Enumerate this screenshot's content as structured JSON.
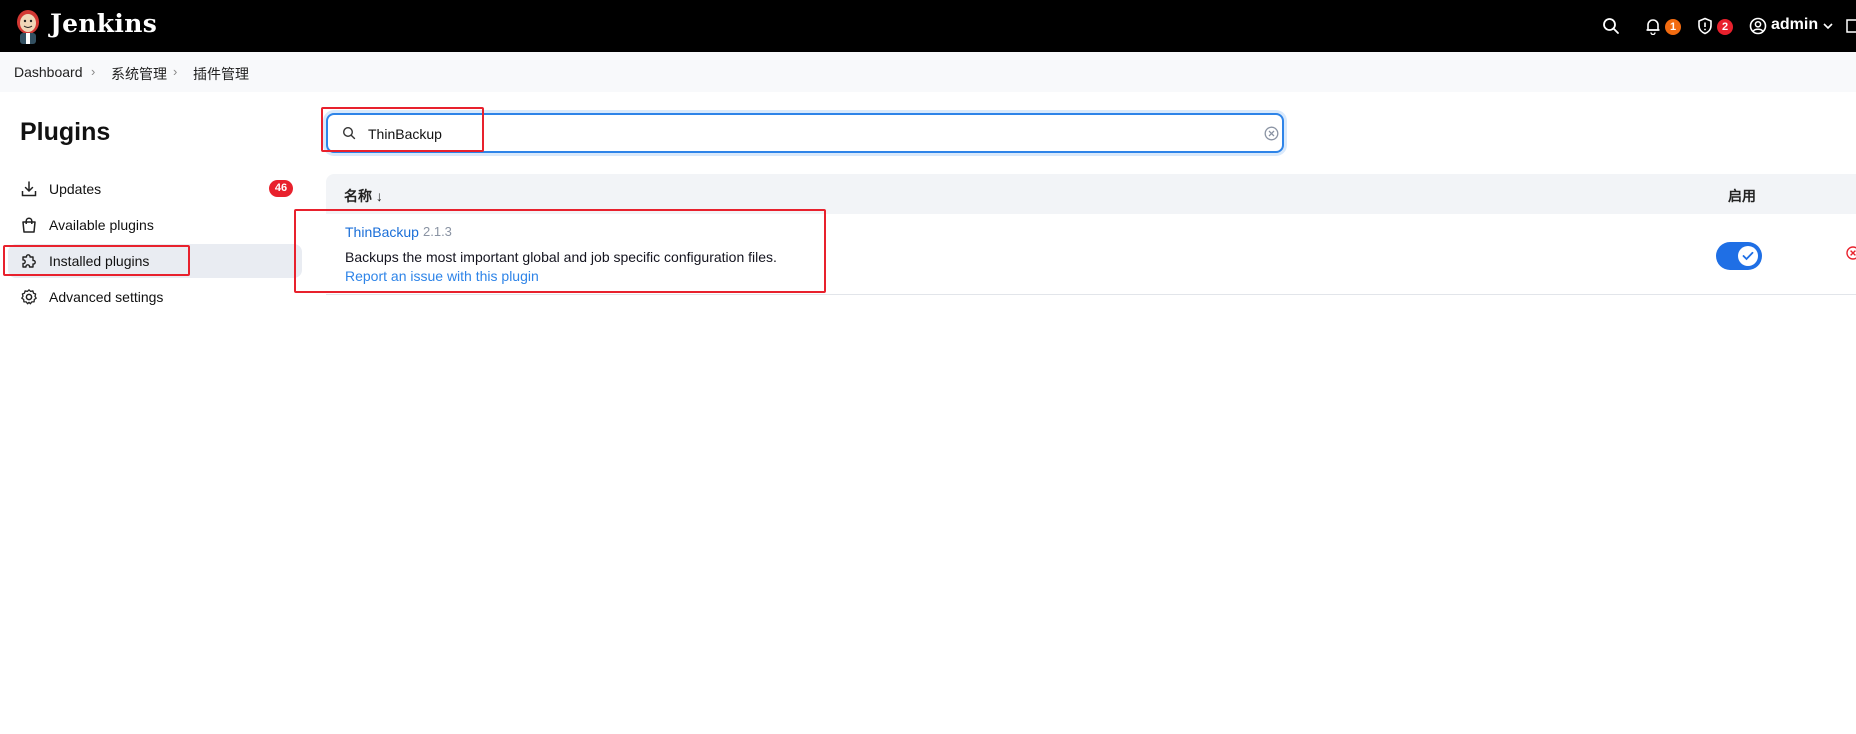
{
  "header": {
    "brand": "Jenkins",
    "notifications_count": "1",
    "security_count": "2",
    "user": "admin",
    "colors": {
      "bg": "#000000",
      "notif_badge": "#f26b10",
      "security_badge": "#e8212d"
    }
  },
  "breadcrumb": [
    "Dashboard",
    "系统管理",
    "插件管理"
  ],
  "sidebar": {
    "title": "Plugins",
    "items": [
      {
        "label": "Updates",
        "icon": "download-icon",
        "badge": "46"
      },
      {
        "label": "Available plugins",
        "icon": "shopping-bag-icon"
      },
      {
        "label": "Installed plugins",
        "icon": "puzzle-icon",
        "active": true
      },
      {
        "label": "Advanced settings",
        "icon": "gear-icon"
      }
    ]
  },
  "search": {
    "value": "ThinBackup",
    "placeholder": ""
  },
  "table": {
    "columns": {
      "name": "名称 ↓",
      "enabled": "启用"
    },
    "rows": [
      {
        "name": "ThinBackup",
        "version": "2.1.3",
        "description": "Backups the most important global and job specific configuration files.",
        "report_link": "Report an issue with this plugin",
        "enabled": true
      }
    ]
  }
}
